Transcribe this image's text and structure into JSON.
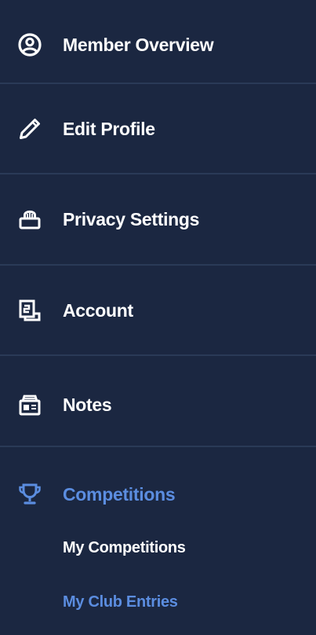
{
  "sidebar": {
    "items": [
      {
        "label": "Member Overview",
        "icon": "user-circle-icon"
      },
      {
        "label": "Edit Profile",
        "icon": "pencil-icon"
      },
      {
        "label": "Privacy Settings",
        "icon": "lock-icon"
      },
      {
        "label": "Account",
        "icon": "account-card-icon"
      },
      {
        "label": "Notes",
        "icon": "notes-box-icon"
      },
      {
        "label": "Competitions",
        "icon": "trophy-icon",
        "active": true
      }
    ],
    "sub_items": [
      {
        "label": "My Competitions"
      },
      {
        "label": "My Club Entries",
        "selected": true
      }
    ]
  },
  "colors": {
    "background": "#1b2741",
    "divider": "#2a3a57",
    "text": "#ffffff",
    "accent": "#5b8de0"
  }
}
